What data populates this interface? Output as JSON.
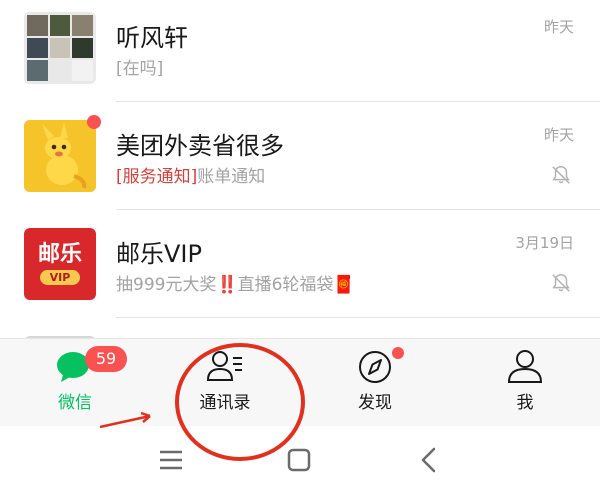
{
  "chats": [
    {
      "title": "听风轩",
      "preview_tag": "",
      "preview": "[在吗]",
      "time": "昨天",
      "avatar": "group-avatar-grid",
      "muted": false,
      "unread_dot": false
    },
    {
      "title": "美团外卖省很多",
      "preview_tag": "[服务通知]",
      "preview": "账单通知",
      "time": "昨天",
      "avatar": "meituan-kangaroo-avatar",
      "muted": true,
      "unread_dot": true
    },
    {
      "title": "邮乐VIP",
      "preview_tag": "",
      "preview": "抽999元大奖‼️直播6轮福袋🧧",
      "time": "3月19日",
      "avatar": "youle-vip-avatar",
      "avatar_text": "邮乐",
      "avatar_badge": "VIP",
      "muted": true,
      "unread_dot": false
    }
  ],
  "tab_bar": {
    "tabs": [
      {
        "label": "微信",
        "icon": "chat-bubble-icon",
        "active": true,
        "badge": "59"
      },
      {
        "label": "通讯录",
        "icon": "contacts-icon",
        "active": false
      },
      {
        "label": "发现",
        "icon": "compass-icon",
        "active": false,
        "dot": true
      },
      {
        "label": "我",
        "icon": "person-icon",
        "active": false
      }
    ]
  },
  "system_nav": {
    "buttons": [
      "menu-lines-icon",
      "home-square-icon",
      "back-chevron-icon"
    ]
  },
  "annotation": {
    "color": "#e0301e",
    "marks": [
      "red-circle-around-contacts-tab",
      "red-arrow-pointing-to-contacts"
    ]
  },
  "colors": {
    "accent_green": "#07c160",
    "badge_red": "#fa5151",
    "service_tag_red": "#d0433f"
  }
}
